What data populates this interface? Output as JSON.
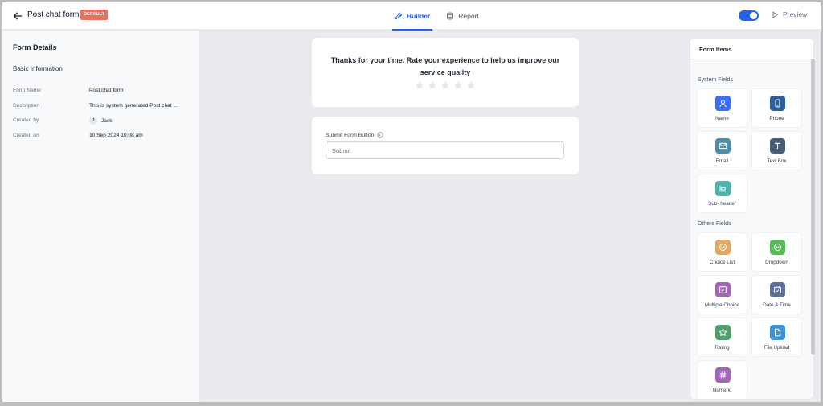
{
  "header": {
    "title": "Post chat form",
    "badge": "DEFAULT",
    "tabs": [
      {
        "label": "Builder",
        "icon": "wrench-icon",
        "active": true
      },
      {
        "label": "Report",
        "icon": "database-icon",
        "active": false
      }
    ],
    "toggle_on": true,
    "preview_label": "Preview"
  },
  "form_details": {
    "title": "Form Details",
    "section": "Basic Information",
    "rows": [
      {
        "label": "Form Name",
        "value": "Post chat form"
      },
      {
        "label": "Description",
        "value": "This is system generated Post chat ..."
      },
      {
        "label": "Created by",
        "value": "Jack",
        "avatar": "J"
      },
      {
        "label": "Created on",
        "value": "10 Sep 2024 10:08 am"
      }
    ]
  },
  "canvas": {
    "rating_question": "Thanks for your time. Rate your experience to help us improve our service quality",
    "rating_stars": 5,
    "submit_label": "Submit Form Button",
    "submit_placeholder": "Submit"
  },
  "form_items": {
    "title": "Form Items",
    "system_label": "System Fields",
    "system": [
      {
        "label": "Name",
        "icon": "user-icon",
        "color": "#3b6ef0"
      },
      {
        "label": "Phone",
        "icon": "phone-icon",
        "color": "#2c5f9e"
      },
      {
        "label": "Email",
        "icon": "email-icon",
        "color": "#4f8ea6"
      },
      {
        "label": "Text Box",
        "icon": "text-icon",
        "color": "#4a5d73"
      },
      {
        "label": "Sub- header",
        "icon": "subheader-icon",
        "color": "#4fb3ad"
      }
    ],
    "others_label": "Others Fields",
    "others": [
      {
        "label": "Choice List",
        "icon": "check-circle-icon",
        "color": "#e0a96a"
      },
      {
        "label": "Dropdown",
        "icon": "chevron-circle-icon",
        "color": "#5cb85c"
      },
      {
        "label": "Multiple Choice",
        "icon": "checkbox-icon",
        "color": "#a067b5"
      },
      {
        "label": "Date & Time",
        "icon": "calendar-icon",
        "color": "#5e6e96"
      },
      {
        "label": "Rating",
        "icon": "star-icon",
        "color": "#4e9e6e"
      },
      {
        "label": "File Upload",
        "icon": "file-icon",
        "color": "#3b94d9"
      },
      {
        "label": "Numeric",
        "icon": "hash-icon",
        "color": "#a067b5"
      }
    ]
  }
}
